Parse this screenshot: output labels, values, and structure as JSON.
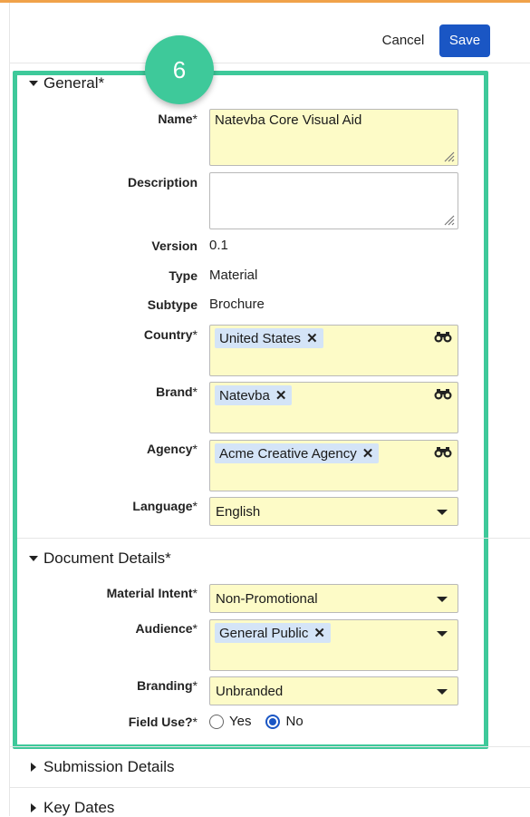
{
  "toolbar": {
    "cancel_label": "Cancel",
    "save_label": "Save"
  },
  "step_badge": "6",
  "colors": {
    "accent_bar": "#f0a24a",
    "save_button": "#1a56c4",
    "highlight": "#3ec99a",
    "required_field_bg": "#fdfbc7",
    "chip_bg": "#d4e4f7"
  },
  "sections": {
    "general": {
      "title": "General",
      "required_mark": "*"
    },
    "document_details": {
      "title": "Document Details",
      "required_mark": "*"
    },
    "submission_details": {
      "title": "Submission Details"
    },
    "key_dates": {
      "title": "Key Dates"
    }
  },
  "fields": {
    "name": {
      "label": "Name",
      "req": "*",
      "value": "Natevba Core Visual Aid"
    },
    "description": {
      "label": "Description",
      "value": ""
    },
    "version": {
      "label": "Version",
      "value": "0.1"
    },
    "type": {
      "label": "Type",
      "value": "Material"
    },
    "subtype": {
      "label": "Subtype",
      "value": "Brochure"
    },
    "country": {
      "label": "Country",
      "req": "*",
      "chip": "United States",
      "icon": "binoculars-icon"
    },
    "brand": {
      "label": "Brand",
      "req": "*",
      "chip": "Natevba",
      "icon": "binoculars-icon"
    },
    "agency": {
      "label": "Agency",
      "req": "*",
      "chip": "Acme Creative Agency",
      "icon": "binoculars-icon"
    },
    "language": {
      "label": "Language",
      "req": "*",
      "value": "English"
    },
    "material_intent": {
      "label": "Material Intent",
      "req": "*",
      "value": "Non-Promotional"
    },
    "audience": {
      "label": "Audience",
      "req": "*",
      "chip": "General Public"
    },
    "branding": {
      "label": "Branding",
      "req": "*",
      "value": "Unbranded"
    },
    "field_use": {
      "label": "Field Use?",
      "req": "*",
      "options": [
        "Yes",
        "No"
      ],
      "selected": "No"
    }
  }
}
